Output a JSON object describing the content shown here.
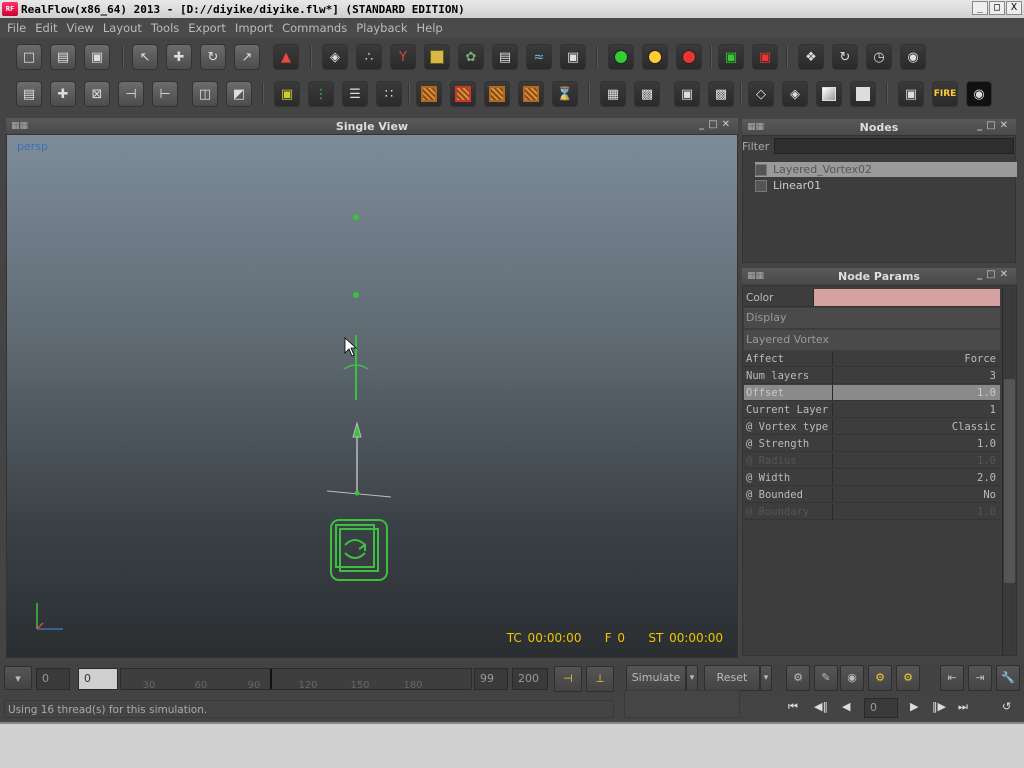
{
  "window": {
    "title": "RealFlow(x86_64) 2013 - [D://diyike/diyike.flw*] (STANDARD EDITION)",
    "logo_text": "RF",
    "minimize": "_",
    "maximize": "□",
    "close": "X"
  },
  "menu": [
    "File",
    "Edit",
    "View",
    "Layout",
    "Tools",
    "Export",
    "Import",
    "Commands",
    "Playback",
    "Help"
  ],
  "viewport": {
    "title": "Single View",
    "camera": "persp",
    "hud_tc": "TC 00:00:00",
    "hud_f": "F 0",
    "hud_st": "ST 00:00:00"
  },
  "nodes_panel": {
    "title": "Nodes",
    "filter_label": "Filter",
    "filter_value": "",
    "items": [
      {
        "label": "Layered_Vortex02",
        "selected": true
      },
      {
        "label": "Linear01",
        "selected": false
      }
    ]
  },
  "params_panel": {
    "title": "Node Params",
    "color_label": "Color",
    "color_value": "#d4a0a0",
    "display_label": "Display",
    "section": "Layered Vortex",
    "rows": [
      {
        "label": "Affect",
        "value": "Force"
      },
      {
        "label": "Num layers",
        "value": "3"
      },
      {
        "label": "Offset",
        "value": "1.0",
        "highlight": true
      },
      {
        "label": "Current Layer",
        "value": "1"
      },
      {
        "label": "@ Vortex type",
        "value": "Classic"
      },
      {
        "label": "@ Strength",
        "value": "1.0"
      },
      {
        "label": "@ Radius",
        "value": "1.0",
        "disabled": true
      },
      {
        "label": "@ Width",
        "value": "2.0"
      },
      {
        "label": "@ Bounded",
        "value": "No"
      },
      {
        "label": "@ Boundary",
        "value": "1.0",
        "disabled": true
      }
    ]
  },
  "timeline": {
    "start": "0",
    "current": "0",
    "ticks": [
      "30",
      "60",
      "90",
      "120",
      "150",
      "180"
    ],
    "end_field": "99",
    "max_field": "200",
    "simulate": "Simulate",
    "reset": "Reset",
    "frame": "0"
  },
  "status": "Using 16 thread(s) for this simulation.",
  "colors": {
    "accent_green": "#3fbf3f",
    "hud_yellow": "#f3c500",
    "persp_blue": "#3c6fb8"
  }
}
